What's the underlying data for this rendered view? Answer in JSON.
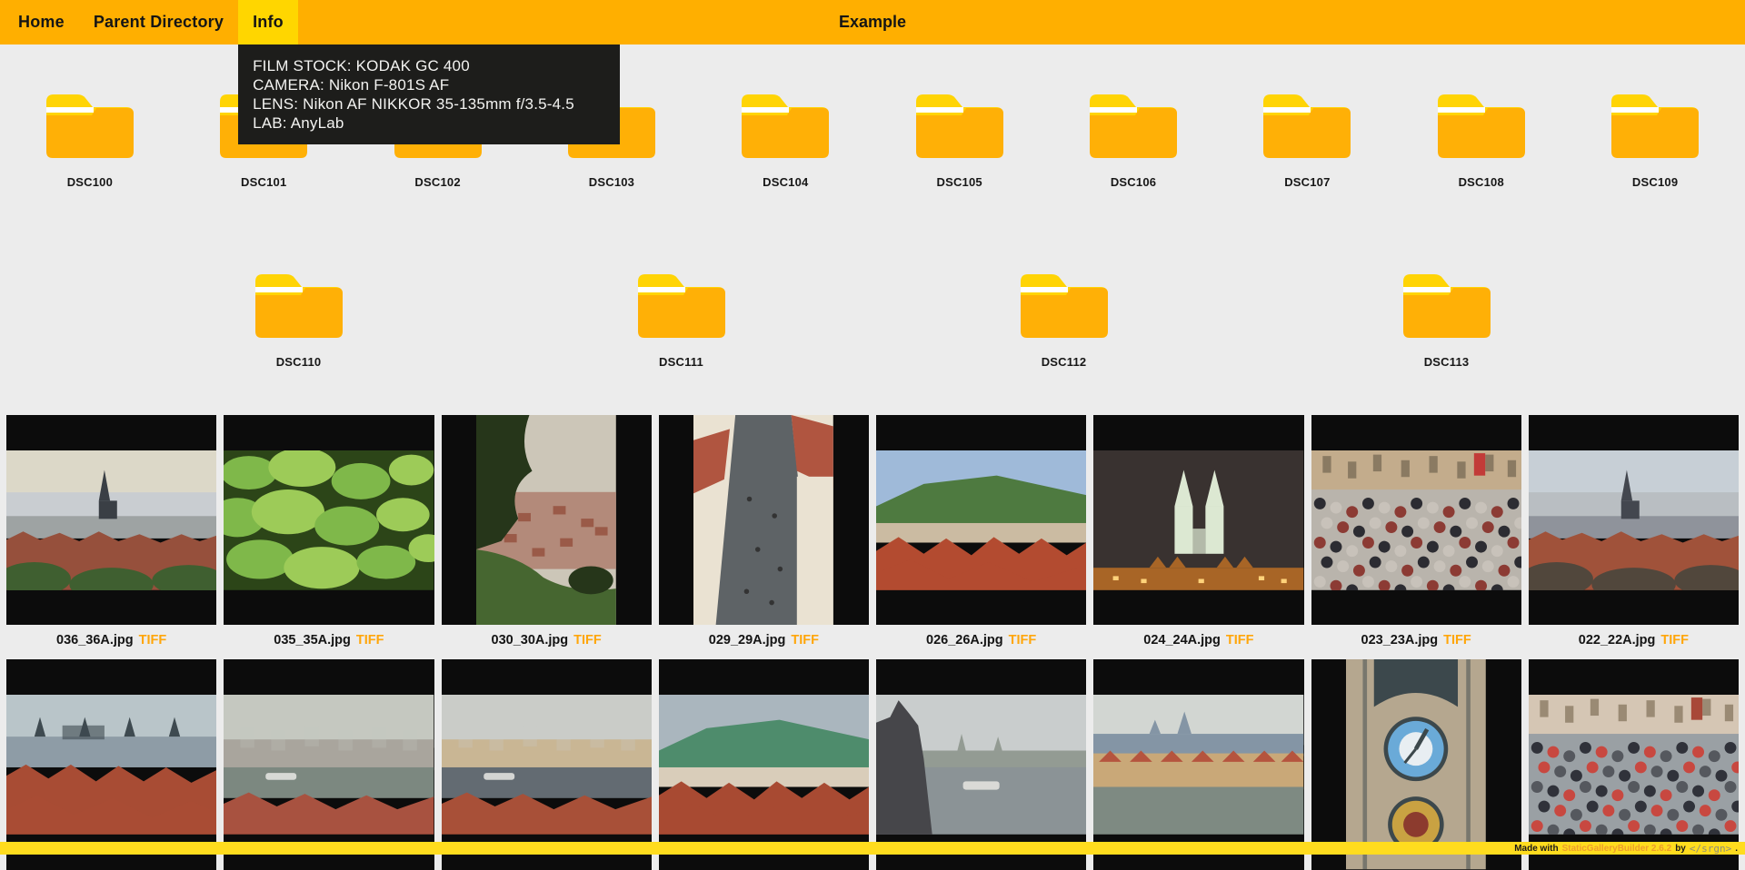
{
  "nav": {
    "items": [
      {
        "id": "home",
        "label": "Home",
        "active": false
      },
      {
        "id": "parent-directory",
        "label": "Parent Directory",
        "active": false
      },
      {
        "id": "info",
        "label": "Info",
        "active": true
      }
    ],
    "title": "Example"
  },
  "info_popup": {
    "lines": [
      "FILM STOCK: KODAK GC 400",
      "CAMERA: Nikon F-801S AF",
      "LENS: Nikon AF NIKKOR 35-135mm f/3.5-4.5",
      "LAB: AnyLab"
    ]
  },
  "folders": [
    "DSC100",
    "DSC101",
    "DSC102",
    "DSC103",
    "DSC104",
    "DSC105",
    "DSC106",
    "DSC107",
    "DSC108",
    "DSC109",
    "DSC110",
    "DSC111",
    "DSC112",
    "DSC113"
  ],
  "gallery": {
    "tiff_label": "TIFF",
    "photos": [
      {
        "file": "036_36A.jpg",
        "orient": "landscape",
        "kind": "skyline",
        "alt": "hazy city panorama with dark cathedral spire, red roofs and trees",
        "colors": [
          "#DCD8C8",
          "#C9CDD1",
          "#9EA3A3",
          "#3A3F45",
          "#96503C",
          "#3F5F30"
        ]
      },
      {
        "file": "035_35A.jpg",
        "orient": "landscape",
        "kind": "foliage",
        "alt": "sunlit green foliage close-up",
        "colors": [
          "#2C4518",
          "#7FB84A",
          "#9DCB58"
        ]
      },
      {
        "file": "030_30A.jpg",
        "orient": "portrait",
        "kind": "treecity",
        "alt": "bare tree overlooking hazy city from hillside",
        "colors": [
          "#CCC6B8",
          "#B38A7A",
          "#9A5A48",
          "#26361A",
          "#466630"
        ]
      },
      {
        "file": "029_29A.jpg",
        "orient": "portrait",
        "kind": "square",
        "alt": "aerial view of town square with red roofed buildings",
        "colors": [
          "#5E6366",
          "#EAE2D2",
          "#B05540",
          "#333333"
        ]
      },
      {
        "file": "026_26A.jpg",
        "orient": "landscape",
        "kind": "roofshill",
        "alt": "red tiled rooftops with green hill and blue sky",
        "colors": [
          "#9FBAD9",
          "#4E7A40",
          "#CBBBA2",
          "#B34B30"
        ]
      },
      {
        "file": "024_24A.jpg",
        "orient": "landscape",
        "kind": "nightchurch",
        "alt": "gothic twin-spired church floodlit at night",
        "colors": [
          "#393230",
          "#A86526",
          "#DCE8D2",
          "#FFD27A"
        ]
      },
      {
        "file": "023_23A.jpg",
        "orient": "landscape",
        "kind": "crowd",
        "alt": "dense tourist crowd on bridge square",
        "colors": [
          "#C3AC8C",
          "#8A7A62",
          "#C23B38",
          "#B9B4AC",
          "#2C2C32",
          "#C8C2BA",
          "#8C3B34"
        ]
      },
      {
        "file": "022_22A.jpg",
        "orient": "landscape",
        "kind": "skyline",
        "alt": "castle hill panorama with cathedral spires and red roofs",
        "colors": [
          "#C7CFD6",
          "#B9BEC2",
          "#8F939B",
          "#43474F",
          "#A0523A",
          "#51473C"
        ]
      },
      {
        "file": "",
        "orient": "landscape",
        "kind": "castleroofs",
        "alt": "misty aerial view of castle and red rooftops",
        "colors": [
          "#B9C5C9",
          "#8E9CA6",
          "#3E4A50",
          "#A84C34"
        ]
      },
      {
        "file": "",
        "orient": "landscape",
        "kind": "riverscape",
        "alt": "foggy river bend with bridges and old town",
        "colors": [
          "#C5C8C0",
          "#A9A59D",
          "#7C8880",
          "#A85240"
        ]
      },
      {
        "file": "",
        "orient": "landscape",
        "kind": "riverscape",
        "alt": "city panorama with river embankment and bridge",
        "colors": [
          "#CACCC8",
          "#C9B694",
          "#636B72",
          "#A85038"
        ]
      },
      {
        "file": "",
        "orient": "landscape",
        "kind": "roofshill",
        "alt": "red rooftops with green church spire under cloudy sky",
        "colors": [
          "#AAB6BE",
          "#4E8C6C",
          "#D9CDBA",
          "#A84A32"
        ]
      },
      {
        "file": "",
        "orient": "landscape",
        "kind": "bridgestatue",
        "alt": "bridge statue silhouette over river with boat and castle skyline",
        "colors": [
          "#C9CDCD",
          "#939B93",
          "#8B9396",
          "#46464A"
        ]
      },
      {
        "file": "",
        "orient": "landscape",
        "kind": "rivercastle",
        "alt": "riverbank houses below castle and cathedral",
        "colors": [
          "#D2D6D2",
          "#8495A5",
          "#C9A878",
          "#B5543E",
          "#7E8A82"
        ]
      },
      {
        "file": "",
        "orient": "portrait",
        "kind": "clock",
        "alt": "astronomical clock tower with two ornate dials",
        "colors": [
          "#B5A78F",
          "#3C484C",
          "#6AAAD8",
          "#E8EEF2",
          "#C9A242",
          "#8C3B2E"
        ]
      },
      {
        "file": "",
        "orient": "landscape",
        "kind": "crowd",
        "alt": "old town street with historic facades and crowds",
        "colors": [
          "#D5C6B4",
          "#9A8A74",
          "#A84838",
          "#9AA0A4",
          "#30323A",
          "#C84840",
          "#55585E"
        ]
      }
    ]
  },
  "footer": {
    "made_with": "Made with",
    "builder": "StaticGalleryBuilder 2.6.2",
    "by": "by",
    "brand": "</srgn>",
    "dot": "."
  },
  "colors": {
    "navbar": "#FFAF00",
    "active_tab": "#FFD600",
    "footer_bar": "#FFDC1E",
    "accent_orange": "#FFA60A",
    "page_bg": "#ECECEC",
    "cell_bg": "#0C0C0C",
    "popup_bg": "#1D1D1B",
    "folder_body": "#FFB006",
    "folder_tab": "#FFD405"
  }
}
